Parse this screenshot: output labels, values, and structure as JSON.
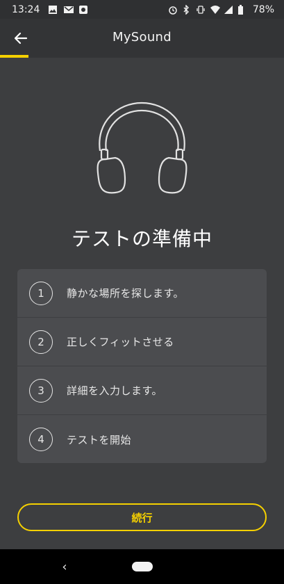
{
  "status_bar": {
    "time": "13:24",
    "battery": "78%",
    "icons_left": [
      "image-icon",
      "gmail-icon",
      "app-notification-icon"
    ],
    "icons_right": [
      "alarm-icon",
      "bluetooth-icon",
      "vibrate-icon",
      "wifi-icon",
      "signal-icon",
      "battery-icon"
    ]
  },
  "header": {
    "title": "MySound",
    "back_icon": "arrow-left-icon",
    "accent_color": "#f5d000"
  },
  "illustration": {
    "icon": "headphones-icon"
  },
  "main": {
    "title": "テストの準備中",
    "steps": [
      {
        "number": "1",
        "label": "静かな場所を探します。"
      },
      {
        "number": "2",
        "label": "正しくフィットさせる"
      },
      {
        "number": "3",
        "label": "詳細を入力します。"
      },
      {
        "number": "4",
        "label": "テストを開始"
      }
    ]
  },
  "actions": {
    "continue_label": "続行"
  },
  "nav": {
    "back_glyph": "‹"
  },
  "colors": {
    "background": "#3d3e40",
    "card": "#4b4c4f",
    "accent": "#f5d000"
  }
}
